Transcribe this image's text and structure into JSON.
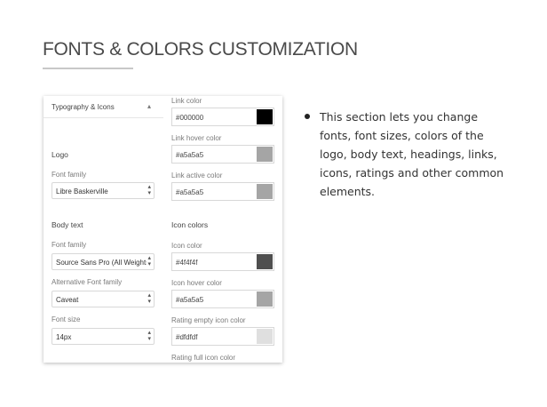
{
  "heading": {
    "title": "FONTS & COLORS CUSTOMIZATION"
  },
  "panel": {
    "accordion_title": "Typography & Icons",
    "left": {
      "logo_label": "Logo",
      "logo_font_family_label": "Font family",
      "logo_font_family_value": "Libre Baskerville",
      "body_text_label": "Body text",
      "body_font_family_label": "Font family",
      "body_font_family_value": "Source Sans Pro (All Weights",
      "alt_font_family_label": "Alternative Font family",
      "alt_font_family_value": "Caveat",
      "font_size_label": "Font size",
      "font_size_value": "14px"
    },
    "right": {
      "link_color_label": "Link color",
      "link_color_value": "#000000",
      "link_hover_label": "Link hover color",
      "link_hover_value": "#a5a5a5",
      "link_active_label": "Link active color",
      "link_active_value": "#a5a5a5",
      "icon_colors_label": "Icon colors",
      "icon_color_label": "Icon color",
      "icon_color_value": "#4f4f4f",
      "icon_hover_label": "Icon hover color",
      "icon_hover_value": "#a5a5a5",
      "rating_empty_label": "Rating empty icon color",
      "rating_empty_value": "#dfdfdf",
      "rating_full_label": "Rating full icon color"
    }
  },
  "description": {
    "bullet": "This section lets you change fonts, font sizes, colors of the logo, body text, headings, links, icons, ratings and other common elements."
  },
  "colors": {
    "swatch_link": "#000000",
    "swatch_link_hover": "#a5a5a5",
    "swatch_link_active": "#a5a5a5",
    "swatch_icon": "#4f4f4f",
    "swatch_icon_hover": "#a5a5a5",
    "swatch_rating_empty": "#dfdfdf"
  }
}
